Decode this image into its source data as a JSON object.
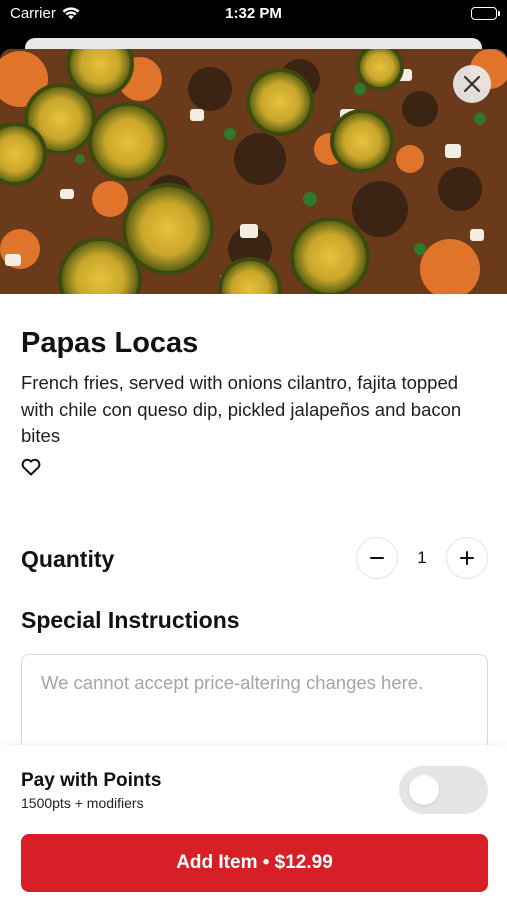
{
  "status_bar": {
    "carrier": "Carrier",
    "time": "1:32 PM",
    "wifi_icon": "wifi-icon",
    "battery_icon": "battery-icon"
  },
  "item": {
    "image_icon": "nachos-photo",
    "name": "Papas Locas",
    "description": "French fries, served with onions cilantro, fajita topped with chile con queso dip, pickled jalapeños and bacon bites",
    "favorite_icon": "heart-icon"
  },
  "quantity": {
    "label": "Quantity",
    "value": "1",
    "minus_icon": "minus-icon",
    "plus_icon": "plus-icon"
  },
  "special_instructions": {
    "label": "Special Instructions",
    "placeholder": "We cannot accept price-altering changes here.",
    "value": ""
  },
  "points": {
    "title": "Pay with Points",
    "subtitle": "1500pts + modifiers",
    "toggle_on": false
  },
  "add_button": {
    "label": "Add Item • $12.99"
  },
  "colors": {
    "accent": "#d61f26",
    "toggle_off": "#e5e5e5"
  }
}
